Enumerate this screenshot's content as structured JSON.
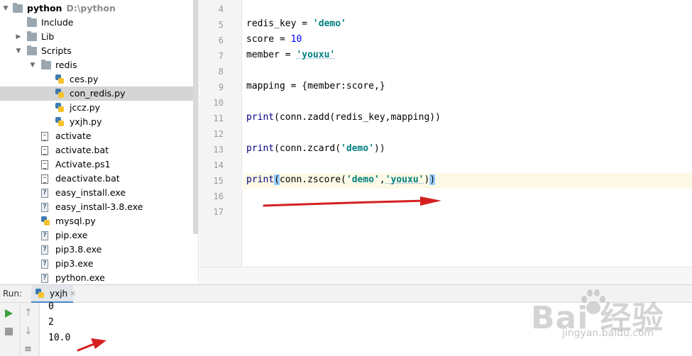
{
  "tree": {
    "root": {
      "name": "python",
      "path": "D:\\python"
    },
    "items": [
      {
        "label": "Include",
        "type": "folder",
        "depth": 1,
        "arrow": ""
      },
      {
        "label": "Lib",
        "type": "folder",
        "depth": 1,
        "arrow": "collapsed"
      },
      {
        "label": "Scripts",
        "type": "folder",
        "depth": 1,
        "arrow": "expanded"
      },
      {
        "label": "redis",
        "type": "folder",
        "depth": 2,
        "arrow": "expanded"
      },
      {
        "label": "ces.py",
        "type": "py",
        "depth": 3
      },
      {
        "label": "con_redis.py",
        "type": "py",
        "depth": 3,
        "selected": true
      },
      {
        "label": "jccz.py",
        "type": "py",
        "depth": 3
      },
      {
        "label": "yxjh.py",
        "type": "py",
        "depth": 3
      },
      {
        "label": "activate",
        "type": "txt",
        "depth": 2
      },
      {
        "label": "activate.bat",
        "type": "txt",
        "depth": 2
      },
      {
        "label": "Activate.ps1",
        "type": "txt",
        "depth": 2
      },
      {
        "label": "deactivate.bat",
        "type": "txt",
        "depth": 2
      },
      {
        "label": "easy_install.exe",
        "type": "unknown",
        "depth": 2
      },
      {
        "label": "easy_install-3.8.exe",
        "type": "unknown",
        "depth": 2
      },
      {
        "label": "mysql.py",
        "type": "py",
        "depth": 2
      },
      {
        "label": "pip.exe",
        "type": "unknown",
        "depth": 2
      },
      {
        "label": "pip3.8.exe",
        "type": "unknown",
        "depth": 2
      },
      {
        "label": "pip3.exe",
        "type": "unknown",
        "depth": 2
      },
      {
        "label": "python.exe",
        "type": "unknown",
        "depth": 2
      }
    ]
  },
  "editor": {
    "line_numbers": [
      "4",
      "5",
      "6",
      "7",
      "8",
      "9",
      "10",
      "11",
      "12",
      "13",
      "14",
      "15",
      "16",
      "17"
    ],
    "current_line": "15",
    "lines": {
      "l5": {
        "a": "redis_key = ",
        "b": "'demo'"
      },
      "l6": {
        "a": "score = ",
        "b": "10"
      },
      "l7": {
        "a": "member = ",
        "b": "'youxu'"
      },
      "l9": {
        "a": "mapping = {member:score,}"
      },
      "l11": {
        "kw": "print",
        "rest": "(conn.zadd(redis_key,mapping))"
      },
      "l13": {
        "kw": "print",
        "a": "(conn.zcard(",
        "s": "'demo'",
        "b": "))"
      },
      "l15": {
        "kw": "print",
        "p": "(",
        "a": "conn.zscore(",
        "s1": "'demo'",
        "c": ",",
        "s2": "'youxu'",
        "b": ")",
        "p2": ")"
      }
    }
  },
  "run": {
    "label": "Run:",
    "tab": "yxjh",
    "close": "×",
    "output": [
      "0",
      "2",
      "10.0"
    ]
  },
  "watermark": {
    "logo": "Bai  经验",
    "url": "jingyan.baidu.com"
  },
  "colors": {
    "arrow": "#d62020",
    "keyword": "#000080",
    "string": "#008080",
    "number": "#0000ff"
  }
}
